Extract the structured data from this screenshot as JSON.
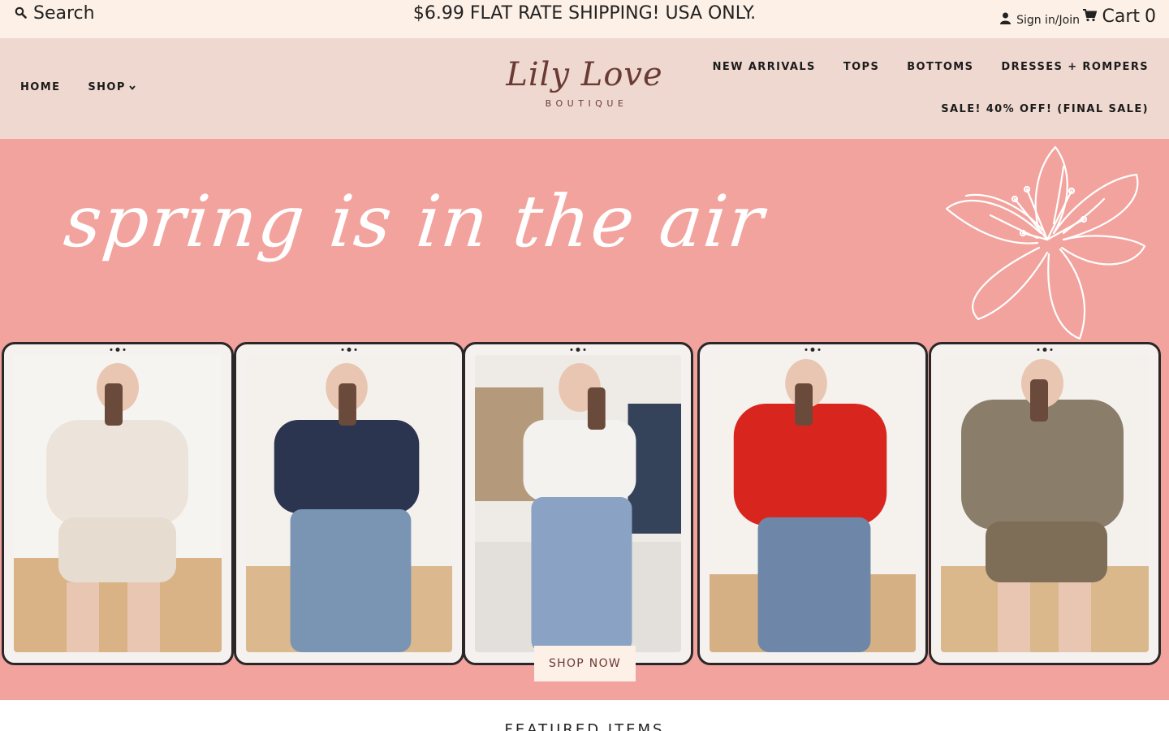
{
  "topbar": {
    "search_label": "Search",
    "announcement": "$6.99 FLAT RATE SHIPPING! USA ONLY.",
    "account_label": "Sign in/Join",
    "cart_label": "Cart",
    "cart_count": "0"
  },
  "header": {
    "nav_left": [
      {
        "label": "HOME"
      },
      {
        "label": "SHOP"
      }
    ],
    "logo": {
      "script": "Lily Love",
      "sub": "BOUTIQUE"
    },
    "nav_right": [
      {
        "label": "NEW ARRIVALS"
      },
      {
        "label": "TOPS"
      },
      {
        "label": "BOTTOMS"
      },
      {
        "label": "DRESSES + ROMPERS"
      },
      {
        "label": "SALE! 40% OFF! (FINAL SALE)"
      }
    ]
  },
  "hero": {
    "headline": "spring is in the air",
    "cta_label": "SHOP NOW",
    "tablets": [
      {
        "top_color": "#ece4da",
        "bottom_color": "#e6dccf"
      },
      {
        "top_color": "#2c3550",
        "bottom_color": "#7a95b4"
      },
      {
        "top_color": "#f4f2ef",
        "bottom_color": "#8aa3c4"
      },
      {
        "top_color": "#d8261f",
        "bottom_color": "#6e87a8"
      },
      {
        "top_color": "#8a7d6a",
        "bottom_color": "#7e6e58"
      }
    ]
  },
  "colors": {
    "topbar_bg": "#fdf0e6",
    "header_bg": "#efd8cf",
    "hero_bg": "#f2a39e",
    "brand": "#6a3a34"
  },
  "icons": {
    "search": "search-icon",
    "account": "user-icon",
    "cart": "cart-icon",
    "dropdown": "chevron-down-icon",
    "flower": "lily-flower-illustration"
  },
  "below_fold": {
    "heading": "FEATURED ITEMS"
  }
}
